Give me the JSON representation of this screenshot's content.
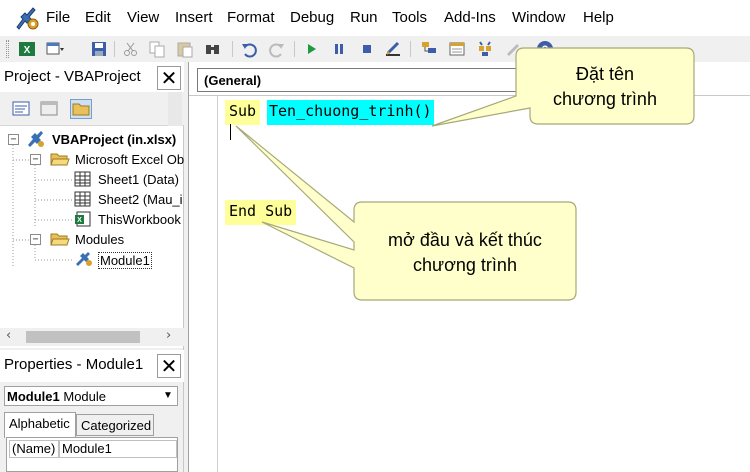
{
  "menu": {
    "items": [
      "File",
      "Edit",
      "View",
      "Insert",
      "Format",
      "Debug",
      "Run",
      "Tools",
      "Add-Ins",
      "Window",
      "Help"
    ]
  },
  "toolbar": {
    "icons": [
      "excel-view-icon",
      "insert-userform-icon",
      "save-icon",
      "cut-icon",
      "copy-icon",
      "paste-icon",
      "find-icon",
      "undo-icon",
      "redo-icon",
      "run-icon",
      "break-icon",
      "reset-icon",
      "design-mode-icon",
      "project-explorer-icon",
      "properties-window-icon",
      "object-browser-icon",
      "toolbox-icon",
      "help-icon"
    ]
  },
  "project_pane": {
    "title": "Project - VBAProject",
    "close": "✕",
    "tree": {
      "root": "VBAProject (in.xlsx)",
      "excel_objects_folder": "Microsoft Excel Ob",
      "sheet1": "Sheet1 (Data)",
      "sheet2": "Sheet2 (Mau_i",
      "workbook": "ThisWorkbook",
      "modules_folder": "Modules",
      "module1": "Module1"
    }
  },
  "properties_pane": {
    "title": "Properties - Module1",
    "close": "✕",
    "selected_object_name": "Module1",
    "selected_object_type": "Module",
    "tabs": [
      "Alphabetic",
      "Categorized"
    ],
    "rows": [
      {
        "name": "(Name)",
        "value": "Module1"
      }
    ]
  },
  "code_window": {
    "object_combo": "(General)",
    "lines": {
      "sub_keyword": "Sub",
      "sub_name": "Ten_chuong_trinh()",
      "end_sub": "End Sub"
    }
  },
  "callouts": {
    "name_callout": [
      "Đặt tên",
      "chương trình"
    ],
    "begin_end_callout": [
      "mở đầu và kết thúc",
      "chương trình"
    ]
  },
  "colors": {
    "callout_fill": "#ffffcc",
    "highlight_yellow": "#ffff99",
    "highlight_cyan": "#00ffff"
  }
}
